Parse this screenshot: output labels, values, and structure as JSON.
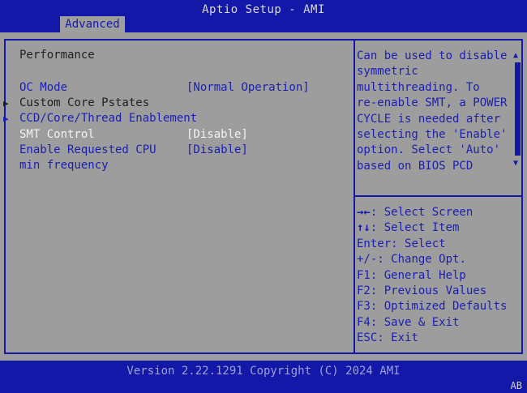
{
  "app": {
    "title": "Aptio Setup - AMI",
    "active_tab": "Advanced"
  },
  "page": {
    "section_title": "Performance",
    "items": [
      {
        "label": "OC Mode",
        "value": "[Normal Operation]",
        "has_submenu": false
      },
      {
        "label": "Custom Core Pstates",
        "value": "",
        "has_submenu": true
      },
      {
        "label": "CCD/Core/Thread Enablement",
        "value": "",
        "has_submenu": true
      },
      {
        "label": "SMT Control",
        "value": "[Disable]",
        "has_submenu": false,
        "selected": true
      },
      {
        "label": "Enable Requested CPU",
        "value": "[Disable]",
        "has_submenu": false
      },
      {
        "label": "min frequency",
        "value": "",
        "has_submenu": false
      }
    ]
  },
  "help": {
    "lines": [
      "Can be used to disable",
      "symmetric",
      "multithreading. To",
      "re-enable SMT, a POWER",
      "CYCLE is needed after",
      "selecting the 'Enable'",
      "option. Select 'Auto'",
      "based on BIOS PCD"
    ]
  },
  "keys": [
    {
      "key": "→←",
      "desc": ": Select Screen"
    },
    {
      "key": "↑↓",
      "desc": ": Select Item"
    },
    {
      "key": "Enter",
      "desc": ": Select"
    },
    {
      "key": "+/-",
      "desc": ": Change Opt."
    },
    {
      "key": "F1",
      "desc": ": General Help"
    },
    {
      "key": "F2",
      "desc": ": Previous Values"
    },
    {
      "key": "F3",
      "desc": ": Optimized Defaults"
    },
    {
      "key": "F4",
      "desc": ": Save & Exit"
    },
    {
      "key": "ESC",
      "desc": ": Exit"
    }
  ],
  "footer": {
    "version": "Version 2.22.1291 Copyright (C) 2024 AMI",
    "corner": "AB"
  },
  "colors": {
    "bios_blue": "#1418a8",
    "panel_gray": "#9d9d9d",
    "item_blue": "#1a1fb0",
    "selected_white": "#f2f2f2"
  },
  "icons": {
    "submenu": "submenu-arrow-icon",
    "scroll_up": "scroll-up-icon",
    "scroll_down": "scroll-down-icon"
  }
}
